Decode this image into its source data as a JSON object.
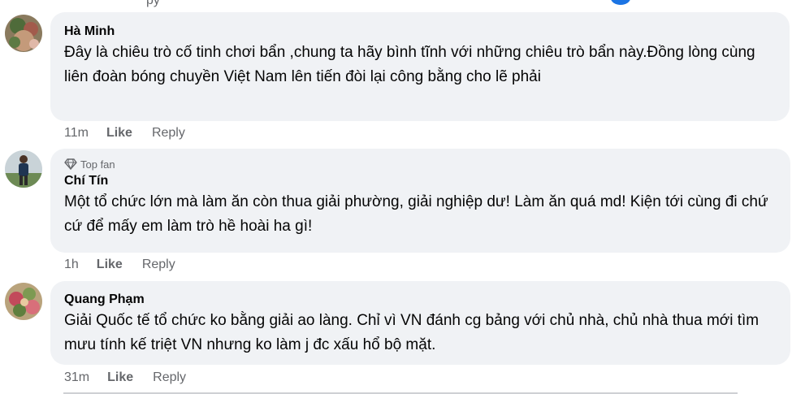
{
  "top_fragment": "py",
  "comments": [
    {
      "author": "Hà Minh",
      "badge": "",
      "text": "Đây là chiêu trò cố tinh chơi bẩn ,chung ta hãy bình tĩnh với những chiêu trò bẩn này.Đồng lòng cùng liên đoàn bóng chuyền Việt Nam lên tiến đòi lại công bằng cho lẽ phải",
      "time": "11m",
      "like_label": "Like",
      "reply_label": "Reply"
    },
    {
      "author": "Chí Tín",
      "badge": "Top fan",
      "badge_icon": "diamond-icon",
      "text": "Một tổ chức lớn mà làm ăn còn thua giải phường, giải nghiệp dư! Làm ăn quá md! Kiện tới cùng đi chứ cứ để mấy em làm trò hề hoài ha gì!",
      "time": "1h",
      "like_label": "Like",
      "reply_label": "Reply"
    },
    {
      "author": "Quang Phạm",
      "badge": "",
      "text": "Giải Quốc tế tổ chức ko bằng giải ao làng. Chỉ vì VN đánh cg bảng với chủ nhà, chủ nhà thua mới tìm mưu tính kế triệt VN nhưng ko làm j đc xấu hổ bộ mặt.",
      "time": "31m",
      "like_label": "Like",
      "reply_label": "Reply"
    }
  ],
  "colors": {
    "bubble": "#f0f2f5",
    "secondary_text": "#65676b",
    "primary_text": "#050505",
    "accent": "#1b74e4"
  }
}
